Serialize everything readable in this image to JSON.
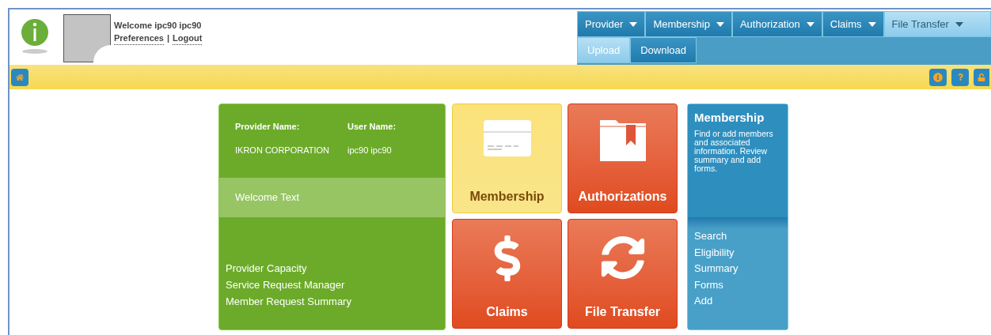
{
  "header": {
    "welcome": "Welcome ipc90 ipc90",
    "links": [
      "Preferences",
      "Logout"
    ],
    "separator": "|"
  },
  "menu": [
    {
      "label": "Provider",
      "selected": false
    },
    {
      "label": "Membership",
      "selected": false
    },
    {
      "label": "Authorization",
      "selected": false
    },
    {
      "label": "Claims",
      "selected": false
    },
    {
      "label": "File Transfer",
      "selected": true
    }
  ],
  "submenu": [
    {
      "label": "Upload",
      "selected": true
    },
    {
      "label": "Download",
      "selected": false
    }
  ],
  "info_card": {
    "fields": [
      {
        "label": "Provider Name:",
        "value": "IKRON CORPORATION"
      },
      {
        "label": "User Name:",
        "value": "ipc90 ipc90"
      }
    ],
    "welcome": "Welcome Text",
    "links": [
      "Provider Capacity",
      "Service Request Manager",
      "Member Request Summary"
    ]
  },
  "tiles": [
    {
      "label": "Membership",
      "selected": true
    },
    {
      "label": "Authorizations",
      "selected": false
    },
    {
      "label": "Claims",
      "selected": false
    },
    {
      "label": "File Transfer",
      "selected": false
    }
  ],
  "detail_panel": {
    "title": "Membership",
    "description": "Find or add members and associated information. Review summary and add forms.",
    "links": [
      "Search",
      "Eligibility",
      "Summary",
      "Forms",
      "Add"
    ]
  }
}
